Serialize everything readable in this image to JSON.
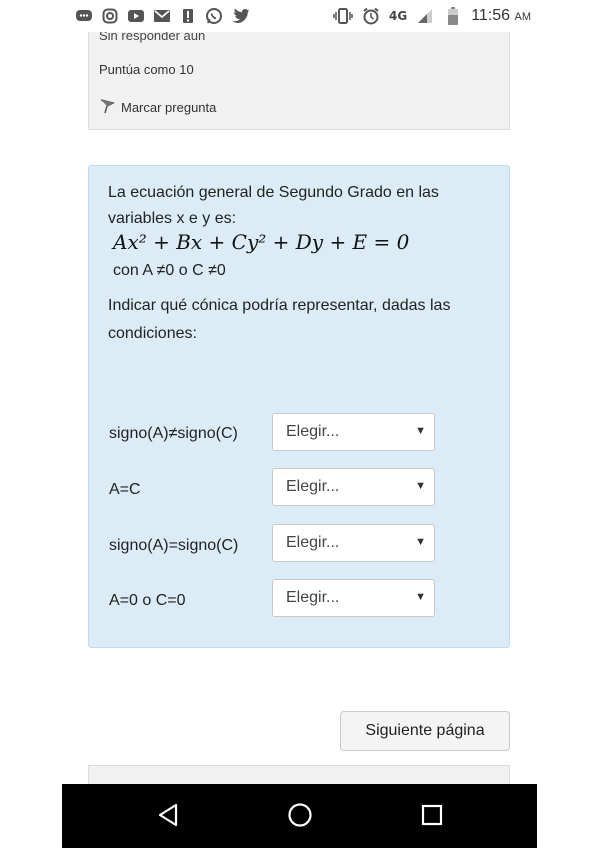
{
  "status_bar": {
    "network": "4G",
    "time": "11:56",
    "ampm": "AM"
  },
  "previous_question": {
    "status": "Sin responder aún",
    "grade": "Puntúa como 10",
    "flag_label": "Marcar pregunta"
  },
  "question": {
    "text": "La ecuación general de Segundo Grado en las variables x e y es:",
    "equation": "Ax² + Bx + Cy² + Dy + E = 0",
    "condition": "con A ≠0 o C ≠0",
    "instruction": "Indicar qué cónica podría representar, dadas las condiciones:",
    "rows": [
      {
        "label": "signo(A)≠signo(C)",
        "selected": "Elegir..."
      },
      {
        "label": "A=C",
        "selected": "Elegir..."
      },
      {
        "label": "signo(A)=signo(C)",
        "selected": "Elegir..."
      },
      {
        "label": "A=0 o C=0",
        "selected": "Elegir..."
      }
    ]
  },
  "navigation": {
    "next_label": "Siguiente página"
  },
  "colors": {
    "question_background": "#dcecf6",
    "info_background": "#f1f1f1",
    "nav_bar": "#000000"
  }
}
